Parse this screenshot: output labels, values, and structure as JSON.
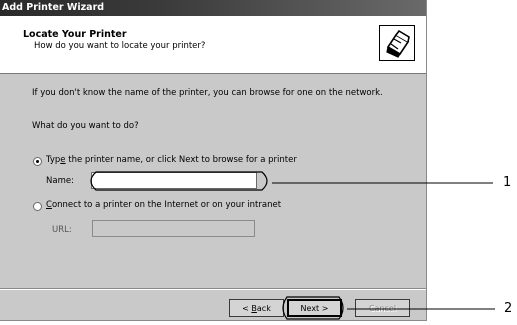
{
  "window": {
    "title": "Add Printer Wizard"
  },
  "header": {
    "title": "Locate Your Printer",
    "subtitle": "How do you want to locate your printer?",
    "icon": "printer-icon"
  },
  "body": {
    "intro": "If you don't know the name of the printer, you can browse for one on the network.",
    "question": "What do you want to do?",
    "options": [
      {
        "label_pre": "Typ",
        "label_accel": "e",
        "label_post": " the printer name, or click Next to browse for a printer",
        "checked": true
      },
      {
        "label_pre": "",
        "label_accel": "C",
        "label_post": "onnect to a printer on the Internet or on your intranet",
        "checked": false
      }
    ],
    "name_label": "Name:",
    "name_value": "",
    "url_label": "URL:",
    "url_value": ""
  },
  "buttons": {
    "back": {
      "pre": "< ",
      "accel": "B",
      "post": "ack"
    },
    "next": "Next >",
    "cancel": "Cancel"
  },
  "callouts": [
    "1",
    "2"
  ]
}
